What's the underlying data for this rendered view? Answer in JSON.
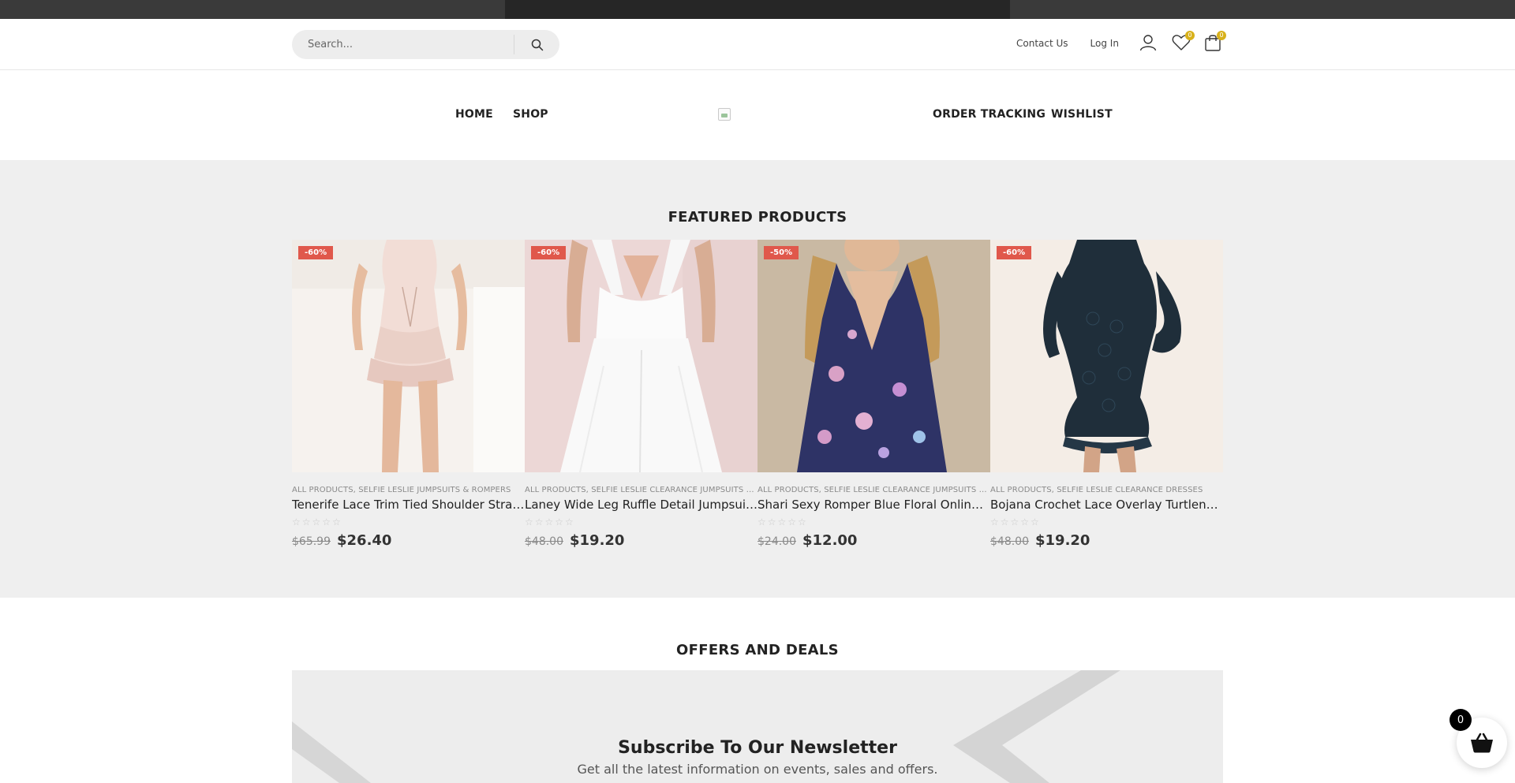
{
  "header": {
    "search_placeholder": "Search...",
    "contact_label": "Contact Us",
    "login_label": "Log In",
    "wishlist_count": "0",
    "cart_count": "0"
  },
  "nav": {
    "items": [
      {
        "label": "HOME"
      },
      {
        "label": "SHOP"
      },
      {
        "label": "ORDER TRACKING"
      },
      {
        "label": "WISHLIST"
      }
    ]
  },
  "featured": {
    "title": "FEATURED PRODUCTS",
    "products": [
      {
        "badge": "-60%",
        "categories": "ALL PRODUCTS, SELFIE LESLIE JUMPSUITS & ROMPERS",
        "name": "Tenerife Lace Trim Tied Shoulder Strap Playsuit",
        "old_price": "$65.99",
        "price": "$26.40",
        "rating": "☆☆☆☆☆"
      },
      {
        "badge": "-60%",
        "categories": "ALL PRODUCTS, SELFIE LESLIE CLEARANCE JUMPSUITS & ROMPERS",
        "name": "Laney Wide Leg Ruffle Detail Jumpsuit White",
        "old_price": "$48.00",
        "price": "$19.20",
        "rating": "☆☆☆☆☆"
      },
      {
        "badge": "-50%",
        "categories": "ALL PRODUCTS, SELFIE LESLIE CLEARANCE JUMPSUITS & ROMPERS",
        "name": "Shari Sexy Romper Blue Floral Online now",
        "old_price": "$24.00",
        "price": "$12.00",
        "rating": "☆☆☆☆☆"
      },
      {
        "badge": "-60%",
        "categories": "ALL PRODUCTS, SELFIE LESLIE CLEARANCE DRESSES",
        "name": "Bojana Crochet Lace Overlay Turtleneck Dress",
        "old_price": "$48.00",
        "price": "$19.20",
        "rating": "☆☆☆☆☆"
      }
    ]
  },
  "offers": {
    "title": "OFFERS AND DEALS",
    "newsletter_title": "Subscribe To Our Newsletter",
    "newsletter_text": "Get all the latest information on events, sales and offers."
  },
  "floating_cart": {
    "count": "0"
  },
  "icons": {
    "search": "search-icon",
    "user": "user-icon",
    "wishlist": "heart-icon",
    "cart": "bag-icon",
    "floating_cart": "basket-icon"
  },
  "colors": {
    "sale_badge": "#e0584b",
    "count_badge": "#d8b11b",
    "section_bg": "#efefef"
  }
}
